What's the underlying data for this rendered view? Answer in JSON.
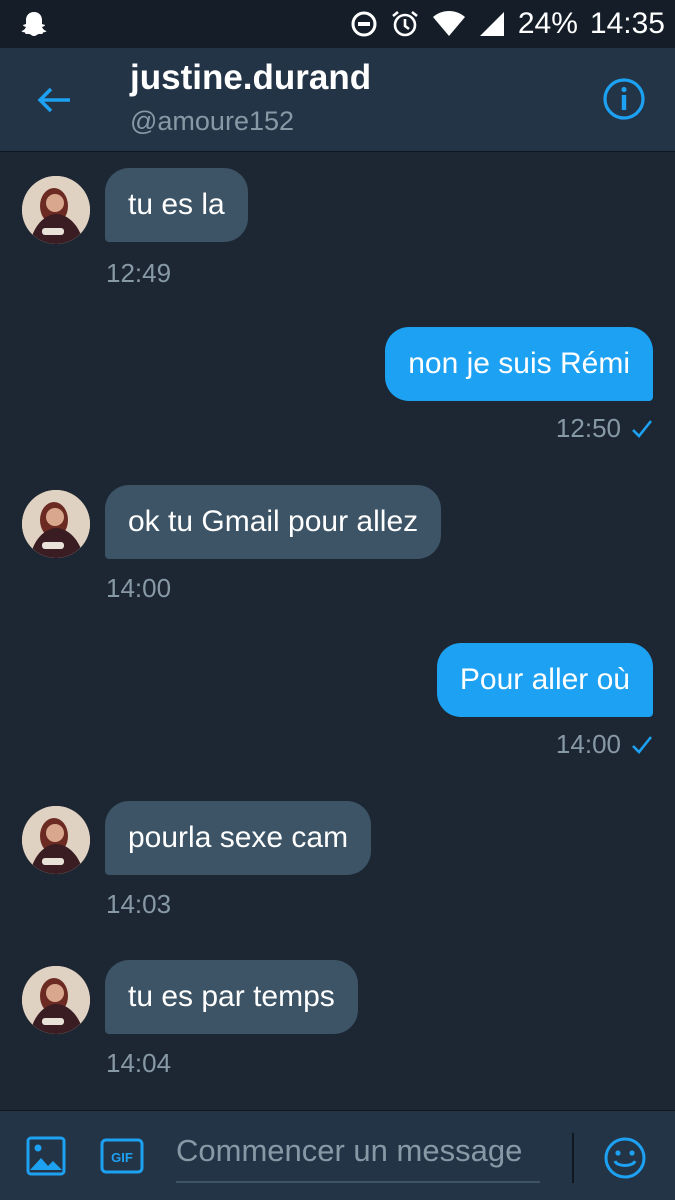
{
  "status_bar": {
    "battery": "24%",
    "time": "14:35",
    "icons": [
      "snapchat-icon",
      "do-not-disturb-icon",
      "alarm-icon",
      "wifi-icon",
      "signal-icon"
    ]
  },
  "header": {
    "title": "justine.durand",
    "handle": "@amoure152",
    "icons": [
      "back-arrow-icon",
      "info-icon"
    ]
  },
  "messages": [
    {
      "direction": "in",
      "text": "tu es la",
      "time": "12:49"
    },
    {
      "direction": "out",
      "text": "non je suis Rémi",
      "time": "12:50",
      "read": true
    },
    {
      "direction": "in",
      "text": "ok tu Gmail pour allez",
      "time": "14:00"
    },
    {
      "direction": "out",
      "text": "Pour aller où",
      "time": "14:00",
      "read": true
    },
    {
      "direction": "in",
      "text": "pourla sexe cam",
      "time": "14:03"
    },
    {
      "direction": "in",
      "text": "tu es par temps",
      "time": "14:04"
    }
  ],
  "composer": {
    "placeholder": "Commencer un message",
    "icons": [
      "image-icon",
      "gif-icon",
      "emoji-icon"
    ]
  },
  "colors": {
    "accent": "#1da1f2",
    "background": "#1c2733",
    "header": "#243447",
    "incoming_bubble": "#3d5466",
    "muted_text": "#8899a6"
  }
}
